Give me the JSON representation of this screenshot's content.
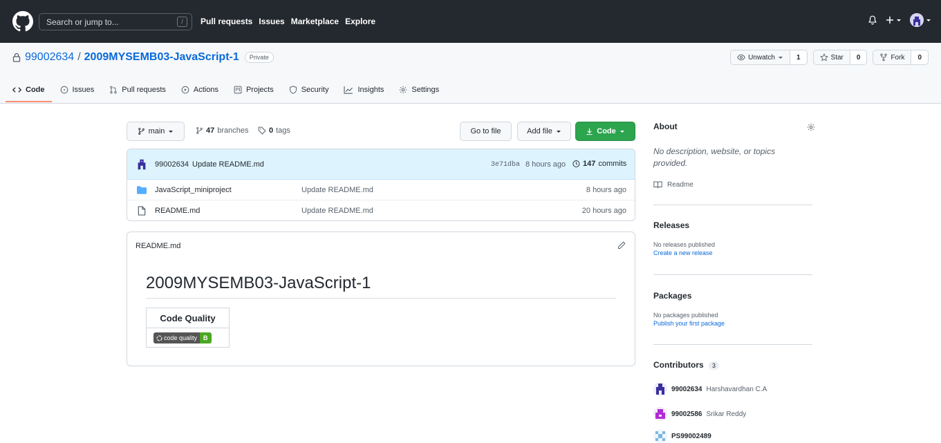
{
  "header": {
    "search_placeholder": "Search or jump to...",
    "slash_key": "/",
    "nav": [
      "Pull requests",
      "Issues",
      "Marketplace",
      "Explore"
    ]
  },
  "repo": {
    "owner": "99002634",
    "separator": "/",
    "name": "2009MYSEMB03-JavaScript-1",
    "visibility": "Private",
    "watch_label": "Unwatch",
    "watch_count": "1",
    "star_label": "Star",
    "star_count": "0",
    "fork_label": "Fork",
    "fork_count": "0"
  },
  "tabs": [
    {
      "label": "Code",
      "icon": "code-icon",
      "active": true
    },
    {
      "label": "Issues",
      "icon": "issue-icon"
    },
    {
      "label": "Pull requests",
      "icon": "pull-request-icon"
    },
    {
      "label": "Actions",
      "icon": "play-icon"
    },
    {
      "label": "Projects",
      "icon": "project-icon"
    },
    {
      "label": "Security",
      "icon": "shield-icon"
    },
    {
      "label": "Insights",
      "icon": "graph-icon"
    },
    {
      "label": "Settings",
      "icon": "gear-icon"
    }
  ],
  "browser": {
    "branch": "main",
    "branches_count": "47",
    "branches_label": "branches",
    "tags_count": "0",
    "tags_label": "tags",
    "go_to_file": "Go to file",
    "add_file": "Add file",
    "code_button": "Code"
  },
  "commit": {
    "author": "99002634",
    "message": "Update README.md",
    "sha": "3e71dba",
    "time": "8 hours ago",
    "count": "147",
    "count_label": "commits"
  },
  "files": [
    {
      "name": "JavaScript_miniproject",
      "type": "folder",
      "message": "Update README.md",
      "time": "8 hours ago"
    },
    {
      "name": "README.md",
      "type": "file",
      "message": "Update README.md",
      "time": "20 hours ago"
    }
  ],
  "readme": {
    "filename": "README.md",
    "heading": "2009MYSEMB03-JavaScript-1",
    "table_header": "Code Quality",
    "badge_label": "code quality",
    "badge_value": "B"
  },
  "about": {
    "title": "About",
    "description": "No description, website, or topics provided.",
    "readme_link": "Readme"
  },
  "releases": {
    "title": "Releases",
    "empty": "No releases published",
    "link": "Create a new release"
  },
  "packages": {
    "title": "Packages",
    "empty": "No packages published",
    "link": "Publish your first package"
  },
  "contributors": {
    "title": "Contributors",
    "count": "3",
    "list": [
      {
        "login": "99002634",
        "name": "Harshavardhan C.A"
      },
      {
        "login": "99002586",
        "name": "Srikar Reddy"
      },
      {
        "login": "PS99002489",
        "name": ""
      }
    ]
  },
  "colors": {
    "header_bg": "#24292f",
    "link": "#0969da",
    "primary_green": "#2da44e",
    "active_tab": "#fd8c73",
    "commit_bar": "#ddf4ff"
  }
}
